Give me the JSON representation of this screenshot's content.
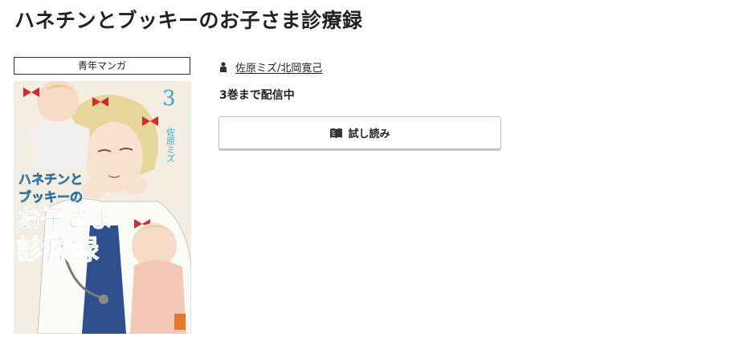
{
  "title": "ハネチンとブッキーのお子さま診療録",
  "genre": "青年マンガ",
  "author": "佐原ミズ/北岡寛己",
  "volume_status": "3巻まで配信中",
  "trial_button": {
    "label": "試し読み",
    "icon": "open-book-icon"
  },
  "cover": {
    "volume_number": "3",
    "cover_title_line1": "ハネチンと",
    "cover_title_line2": "ブッキーの",
    "cover_title_line3": "お子さま",
    "cover_title_line4": "診療録",
    "cover_author": "佐原ミズ"
  },
  "colors": {
    "text": "#222222",
    "border": "#333333",
    "button_border": "#bdbdbd",
    "cover_accent": "#3aa7c9",
    "ribbon": "#d52b2b"
  }
}
